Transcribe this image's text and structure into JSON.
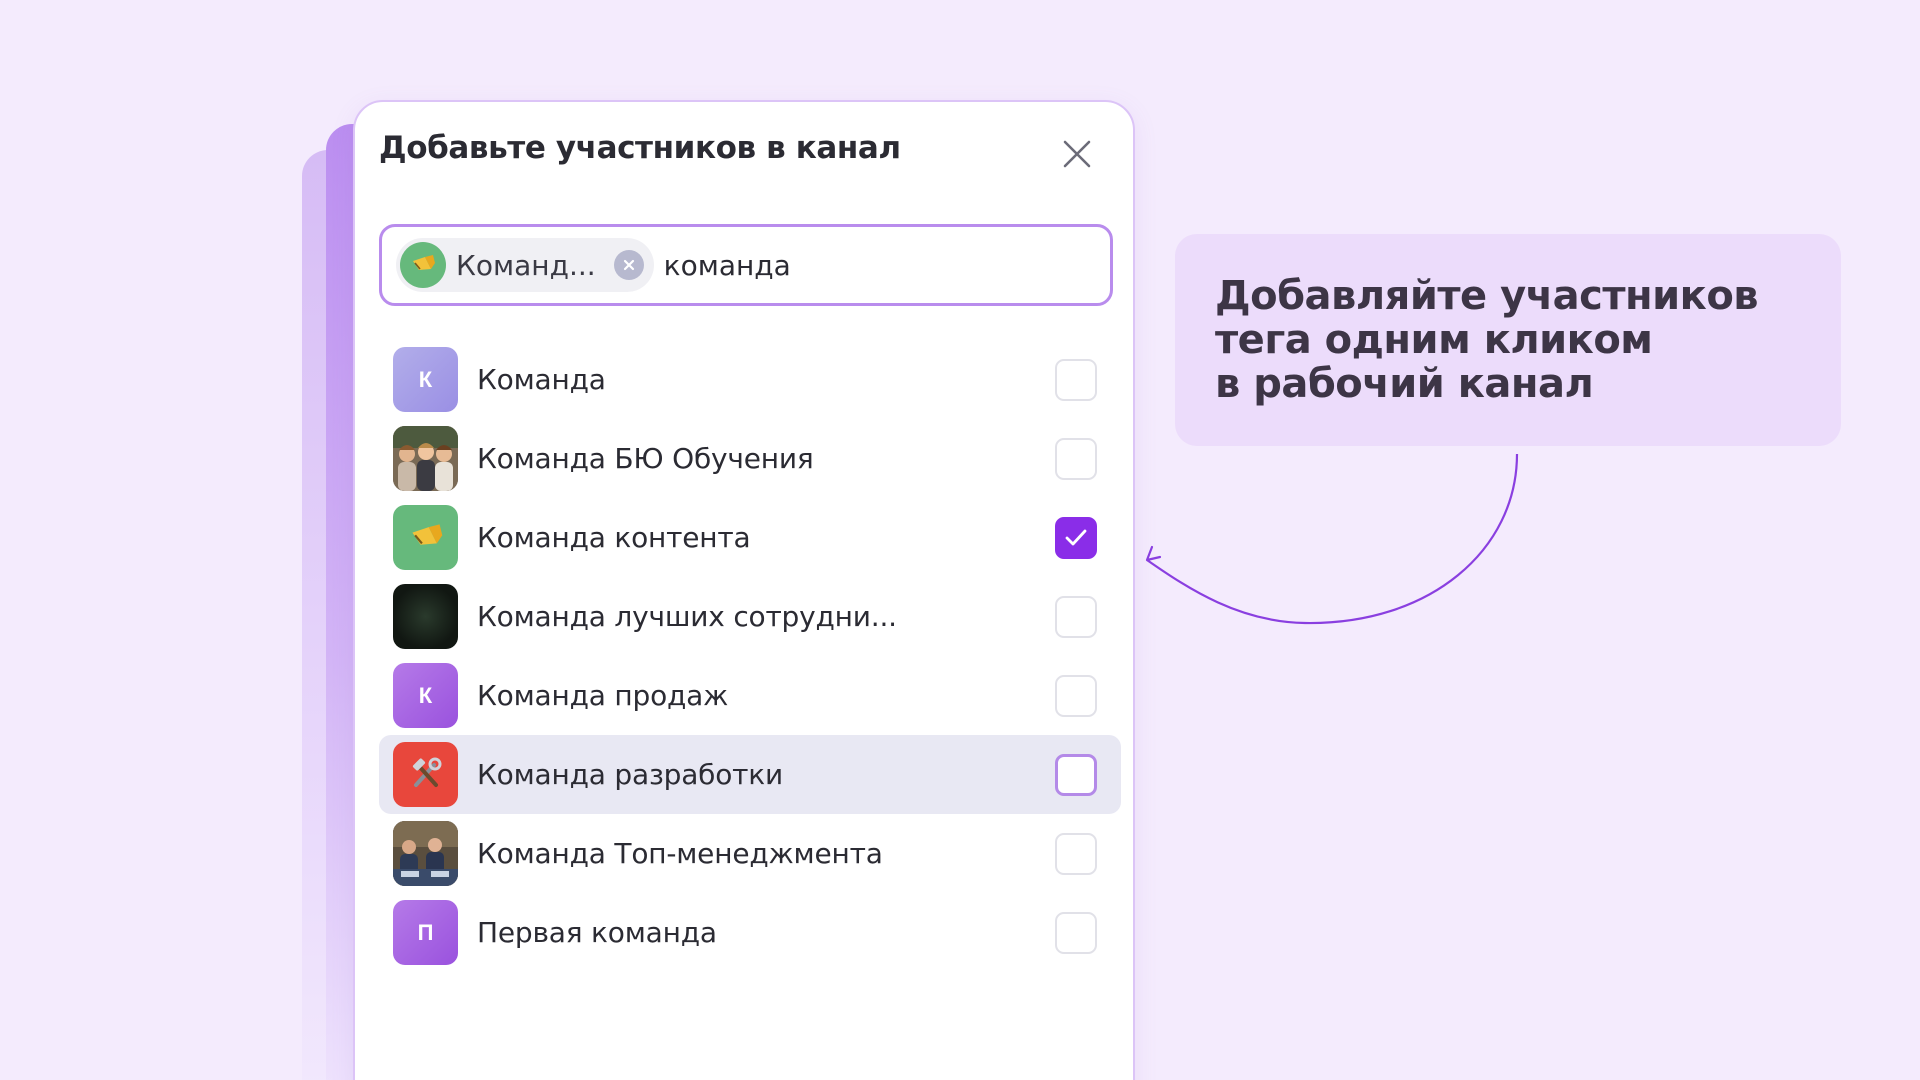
{
  "dialog": {
    "title": "Добавьте участников в канал",
    "close_icon": "close-icon"
  },
  "search": {
    "chip_label": "Команд...",
    "chip_icon": "megaphone-icon",
    "query": "команда"
  },
  "list": {
    "items": [
      {
        "label": "Команда",
        "avatar_letter": "К",
        "avatar_type": "letter",
        "checked": false
      },
      {
        "label": "Команда БЮ Обучения",
        "avatar_type": "photo-group-women",
        "checked": false
      },
      {
        "label": "Команда контента",
        "avatar_type": "megaphone-icon",
        "checked": true
      },
      {
        "label": "Команда лучших сотрудни...",
        "avatar_type": "photo-dark",
        "checked": false
      },
      {
        "label": "Команда продаж",
        "avatar_letter": "К",
        "avatar_type": "letter",
        "checked": false
      },
      {
        "label": "Команда разработки",
        "avatar_type": "hammer-wrench-icon",
        "checked": false,
        "highlighted": true
      },
      {
        "label": "Команда Топ-менеджмента",
        "avatar_type": "photo-office",
        "checked": false
      },
      {
        "label": "Первая команда",
        "avatar_letter": "П",
        "avatar_type": "letter",
        "checked": false
      }
    ]
  },
  "info_card": {
    "line1": "Добавляйте участников",
    "line2": "тега одним кликом",
    "line3": "в рабочий канал"
  },
  "colors": {
    "background": "#f4ebfd",
    "accent": "#8a2de8",
    "search_border": "#b98ced",
    "card_bg": "#ecdcfb",
    "highlight_row": "#e8e8f3"
  }
}
